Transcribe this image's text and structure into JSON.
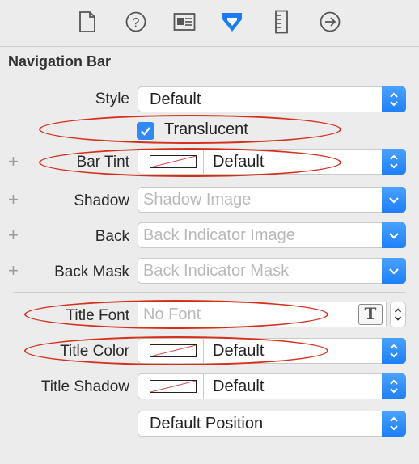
{
  "toolbar": {
    "icons": [
      "file-inspector-icon",
      "quick-help-icon",
      "identity-inspector-icon",
      "attributes-inspector-icon",
      "size-inspector-icon",
      "connections-inspector-icon"
    ]
  },
  "section": {
    "title": "Navigation Bar"
  },
  "style": {
    "label": "Style",
    "value": "Default"
  },
  "translucent": {
    "label": "Translucent",
    "checked": true
  },
  "bar_tint": {
    "label": "Bar Tint",
    "value": "Default"
  },
  "shadow": {
    "label": "Shadow",
    "placeholder": "Shadow Image"
  },
  "back": {
    "label": "Back",
    "placeholder": "Back Indicator Image"
  },
  "back_mask": {
    "label": "Back Mask",
    "placeholder": "Back Indicator Mask"
  },
  "title_font": {
    "label": "Title Font",
    "placeholder": "No Font",
    "button": "T"
  },
  "title_color": {
    "label": "Title Color",
    "value": "Default"
  },
  "title_shadow": {
    "label": "Title Shadow",
    "value": "Default"
  },
  "position": {
    "value": "Default Position"
  },
  "plus_sign": "+",
  "colors": {
    "accent": "#2f8af8",
    "annotation": "#d6301d"
  }
}
